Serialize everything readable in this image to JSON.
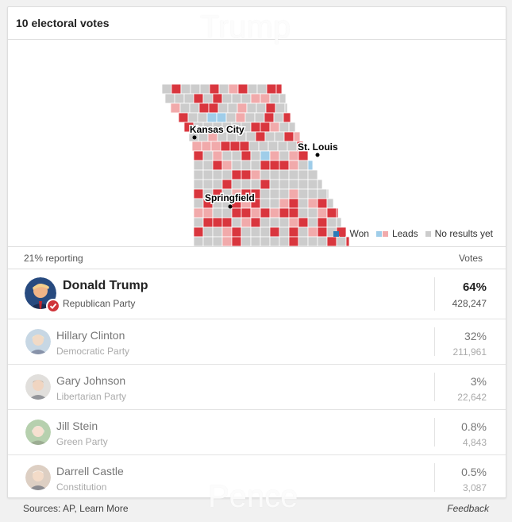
{
  "header": {
    "title": "10 electoral votes"
  },
  "watermarks": {
    "top": "Trump",
    "bottom": "Pence"
  },
  "map": {
    "cities": [
      {
        "name": "Kansas City"
      },
      {
        "name": "St. Louis"
      },
      {
        "name": "Springfield"
      }
    ],
    "colors": {
      "won_dem": "#2a7ab8",
      "won_rep": "#d9363e",
      "lead_dem": "#9fcde9",
      "lead_rep": "#f1aaab",
      "none": "#cccccc"
    }
  },
  "legend": {
    "won": "Won",
    "leads": "Leads",
    "none": "No results yet"
  },
  "reporting": {
    "text": "21% reporting",
    "votes_header": "Votes"
  },
  "candidates": [
    {
      "name": "Donald Trump",
      "party": "Republican Party",
      "pct": "64%",
      "votes": "428,247",
      "winner": true
    },
    {
      "name": "Hillary Clinton",
      "party": "Democratic Party",
      "pct": "32%",
      "votes": "211,961"
    },
    {
      "name": "Gary Johnson",
      "party": "Libertarian Party",
      "pct": "3%",
      "votes": "22,642"
    },
    {
      "name": "Jill Stein",
      "party": "Green Party",
      "pct": "0.8%",
      "votes": "4,843"
    },
    {
      "name": "Darrell Castle",
      "party": "Constitution",
      "pct": "0.5%",
      "votes": "3,087"
    }
  ],
  "footer": {
    "sources": "Sources: AP, Learn More",
    "feedback": "Feedback"
  }
}
